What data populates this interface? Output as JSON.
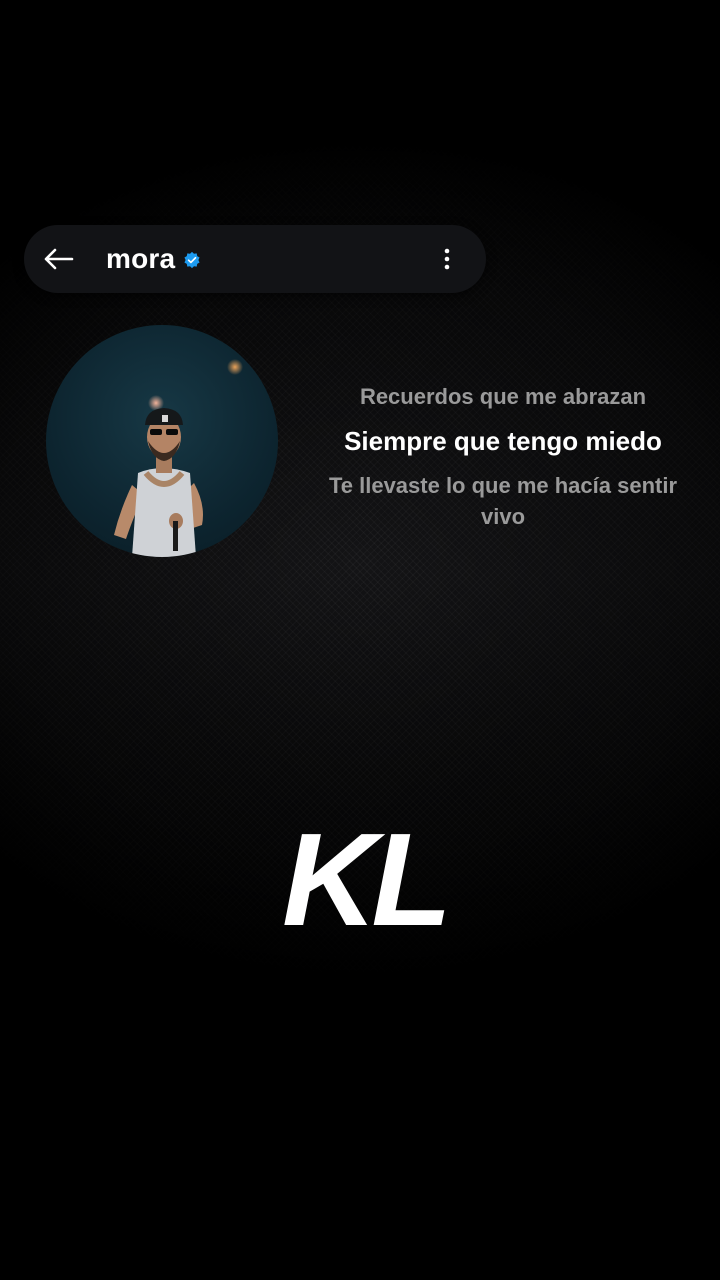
{
  "header": {
    "back_icon": "arrow-left-icon",
    "username": "mora",
    "verified_icon": "verified-badge-icon",
    "verified_color": "#1d9bf0",
    "more_icon": "more-vertical-icon"
  },
  "profile": {
    "avatar_icon": "artist-avatar-photo"
  },
  "lyrics": {
    "previous": "Recuerdos que me abrazan",
    "current": "Siempre que tengo miedo",
    "next": "Te llevaste lo que me hacía sentir vivo"
  },
  "brand": {
    "logo_text": "KL"
  }
}
